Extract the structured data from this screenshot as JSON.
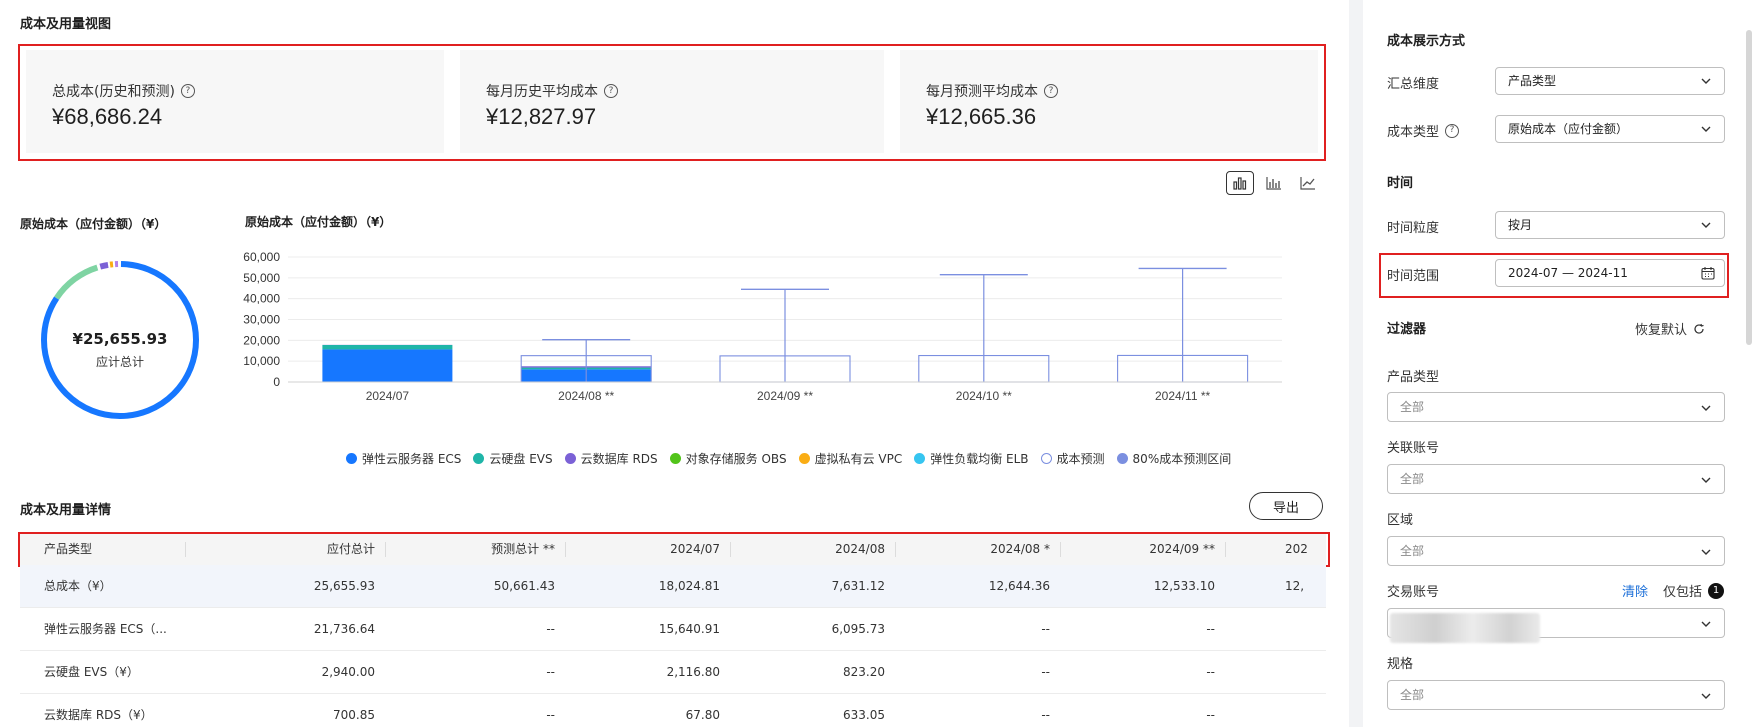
{
  "page": {
    "title": "成本及用量视图"
  },
  "kpis": [
    {
      "label": "总成本(历史和预测)",
      "value": "¥68,686.24"
    },
    {
      "label": "每月历史平均成本",
      "value": "¥12,827.97"
    },
    {
      "label": "每月预测平均成本",
      "value": "¥12,665.36"
    }
  ],
  "view_switch": {
    "active": "bar-stacked"
  },
  "donut": {
    "title": "原始成本（应付金额）（¥）",
    "center_value": "¥25,655.93",
    "center_label": "应计总计"
  },
  "chart_data": {
    "type": "bar",
    "title": "原始成本（应付金额）（¥）",
    "categories": [
      "2024/07",
      "2024/08 **",
      "2024/09 **",
      "2024/10 **",
      "2024/11 **"
    ],
    "ylim": [
      0,
      60000
    ],
    "yticks": [
      "60,000",
      "50,000",
      "40,000",
      "30,000",
      "20,000",
      "10,000",
      "0"
    ],
    "series": [
      {
        "name": "弹性云服务器 ECS",
        "color": "#1677ff",
        "values": [
          15640.91,
          6095.73,
          0,
          0,
          0
        ]
      },
      {
        "name": "云硬盘 EVS",
        "color": "#1fb5a8",
        "values": [
          2116.8,
          823.2,
          0,
          0,
          0
        ]
      },
      {
        "name": "云数据库 RDS",
        "color": "#7b61d6",
        "values": [
          67.8,
          633.05,
          0,
          0,
          0
        ]
      }
    ],
    "forecast": {
      "name": "成本预测",
      "values": [
        null,
        12644.36,
        12533.1,
        12700,
        12750
      ]
    },
    "forecast_range_80": {
      "name": "80%成本预测区间",
      "upper": [
        null,
        20300,
        44500,
        51500,
        54500
      ],
      "lower": [
        null,
        0,
        0,
        0,
        0
      ]
    },
    "grid": true
  },
  "legend": [
    {
      "name": "弹性云服务器 ECS",
      "color": "#1677ff",
      "hollow": false
    },
    {
      "name": "云硬盘 EVS",
      "color": "#1fb5a8",
      "hollow": false
    },
    {
      "name": "云数据库 RDS",
      "color": "#7b61d6",
      "hollow": false
    },
    {
      "name": "对象存储服务 OBS",
      "color": "#52c41a",
      "hollow": false
    },
    {
      "name": "虚拟私有云 VPC",
      "color": "#faad14",
      "hollow": false
    },
    {
      "name": "弹性负载均衡 ELB",
      "color": "#36c5f0",
      "hollow": false
    },
    {
      "name": "成本预测",
      "color": "#7b8fe0",
      "hollow": true
    },
    {
      "name": "80%成本预测区间",
      "color": "#7b8fe0",
      "hollow": false
    }
  ],
  "detail": {
    "title": "成本及用量详情",
    "export_label": "导出",
    "columns": [
      "产品类型",
      "应付总计",
      "预测总计 **",
      "2024/07",
      "2024/08",
      "2024/08 *",
      "2024/09 **",
      "202"
    ],
    "rows": [
      [
        "总成本（¥）",
        "25,655.93",
        "50,661.43",
        "18,024.81",
        "7,631.12",
        "12,644.36",
        "12,533.10",
        "12,"
      ],
      [
        "弹性云服务器 ECS（...",
        "21,736.64",
        "--",
        "15,640.91",
        "6,095.73",
        "--",
        "--",
        ""
      ],
      [
        "云硬盘 EVS（¥）",
        "2,940.00",
        "--",
        "2,116.80",
        "823.20",
        "--",
        "--",
        ""
      ],
      [
        "云数据库 RDS（¥）",
        "700.85",
        "--",
        "67.80",
        "633.05",
        "--",
        "--",
        ""
      ]
    ]
  },
  "sidebar": {
    "section_display": "成本展示方式",
    "summary_dim_label": "汇总维度",
    "summary_dim_value": "产品类型",
    "cost_type_label": "成本类型",
    "cost_type_value": "原始成本（应付金额）",
    "section_time": "时间",
    "granularity_label": "时间粒度",
    "granularity_value": "按月",
    "range_label": "时间范围",
    "range_value": "2024-07 — 2024-11",
    "section_filter": "过滤器",
    "reset_label": "恢复默认",
    "product_type_label": "产品类型",
    "product_type_value": "全部",
    "linked_account_label": "关联账号",
    "linked_account_value": "全部",
    "region_label": "区域",
    "region_value": "全部",
    "trade_account_label": "交易账号",
    "clear_label": "清除",
    "only_include_label": "仅包括",
    "only_include_count": "1",
    "spec_label": "规格",
    "spec_value": "全部"
  }
}
